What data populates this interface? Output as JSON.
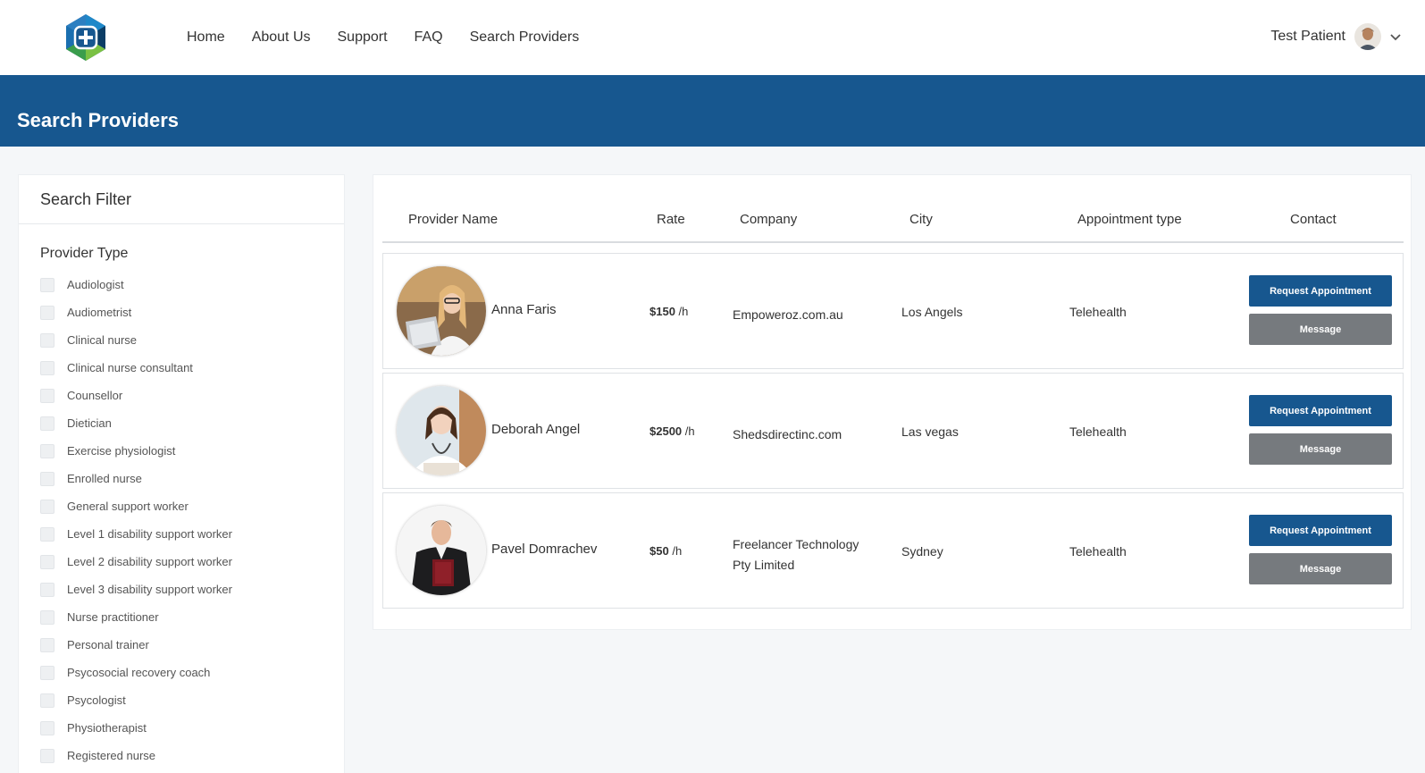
{
  "nav": {
    "items": [
      "Home",
      "About Us",
      "Support",
      "FAQ",
      "Search Providers"
    ],
    "user_name": "Test Patient"
  },
  "banner": {
    "title": "Search Providers"
  },
  "filter": {
    "title": "Search Filter",
    "section": "Provider Type",
    "options": [
      "Audiologist",
      "Audiometrist",
      "Clinical nurse",
      "Clinical nurse consultant",
      "Counsellor",
      "Dietician",
      "Exercise physiologist",
      "Enrolled nurse",
      "General support worker",
      "Level 1 disability support worker",
      "Level 2 disability support worker",
      "Level 3 disability support worker",
      "Nurse practitioner",
      "Personal trainer",
      "Psycosocial recovery coach",
      "Psycologist",
      "Physiotherapist",
      "Registered nurse"
    ]
  },
  "table": {
    "headers": {
      "name": "Provider Name",
      "rate": "Rate",
      "company": "Company",
      "city": "City",
      "appt": "Appointment type",
      "contact": "Contact"
    },
    "rate_unit": "/h",
    "request_label": "Request Appointment",
    "message_label": "Message",
    "rows": [
      {
        "name": "Anna Faris",
        "rate": "$150",
        "company": "Empoweroz.com.au",
        "city": "Los Angels",
        "appt": "Telehealth"
      },
      {
        "name": "Deborah Angel",
        "rate": "$2500",
        "company": "Shedsdirectinc.com",
        "city": "Las vegas",
        "appt": "Telehealth"
      },
      {
        "name": "Pavel Domrachev",
        "rate": "$50",
        "company": "Freelancer Technology Pty Limited",
        "city": "Sydney",
        "appt": "Telehealth"
      }
    ]
  },
  "colors": {
    "primary": "#17578f",
    "secondary_button": "#767a7e",
    "page_bg": "#f5f7f9"
  }
}
